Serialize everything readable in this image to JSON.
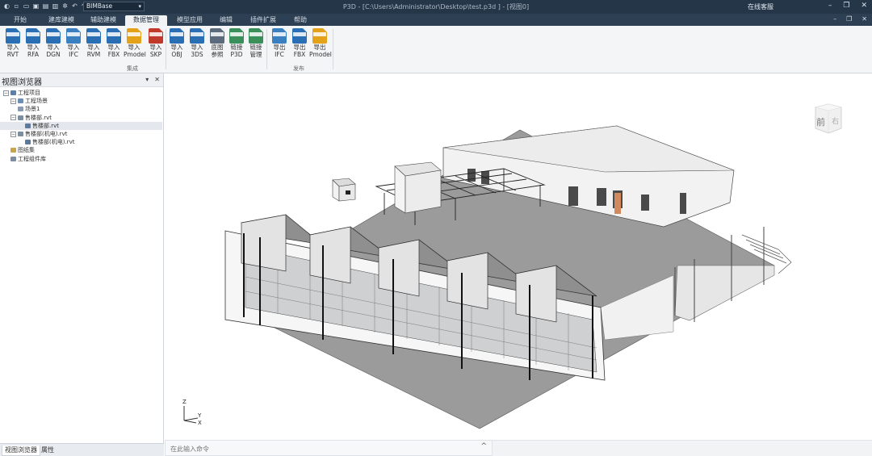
{
  "titlebar": {
    "quick_access_icons": [
      "app-logo-icon",
      "new-file-icon",
      "open-folder-icon",
      "save-icon",
      "save-as-icon",
      "print-icon",
      "settings-icon",
      "undo-icon",
      "redo-icon",
      "more-icon"
    ],
    "workspace": "BIMBase",
    "title": "P3D - [C:\\Users\\Administrator\\Desktop\\test.p3d ] - [视图0]",
    "online_service": "在线客服",
    "window_controls": [
      "minimize-icon",
      "restore-icon",
      "close-icon"
    ]
  },
  "menu": {
    "tabs": [
      "开始",
      "建库建模",
      "辅助建模",
      "数据管理",
      "模型应用",
      "编辑",
      "插件扩展",
      "帮助"
    ],
    "active": "数据管理",
    "mdi_controls": [
      "minimize-icon",
      "restore-icon",
      "close-icon"
    ]
  },
  "ribbon": {
    "buttons": [
      {
        "l1": "导入",
        "l2": "RVT",
        "color": "#2a6fb3",
        "tag": "RVT"
      },
      {
        "l1": "导入",
        "l2": "RFA",
        "color": "#2a6fb3",
        "tag": "RFA"
      },
      {
        "l1": "导入",
        "l2": "DGN",
        "color": "#2a6fb3",
        "tag": "DGN"
      },
      {
        "l1": "导入",
        "l2": "IFC",
        "color": "#3a7fbf",
        "tag": "IFC"
      },
      {
        "l1": "导入",
        "l2": "RVM",
        "color": "#2a6fb3",
        "tag": "RVM"
      },
      {
        "l1": "导入",
        "l2": "FBX",
        "color": "#2a6fb3",
        "tag": "FBX"
      },
      {
        "l1": "导入",
        "l2": "Pmodel",
        "color": "#e3a21a",
        "tag": "Pm"
      },
      {
        "l1": "导入",
        "l2": "SKP",
        "color": "#c0392b",
        "tag": "SKP"
      },
      {
        "l1": "导入",
        "l2": "OBJ",
        "color": "#2a6fb3",
        "tag": "OBJ"
      },
      {
        "l1": "导入",
        "l2": "3DS",
        "color": "#2a6fb3",
        "tag": "3DS"
      },
      {
        "l1": "底图",
        "l2": "参照",
        "color": "#5b6b7c",
        "tag": "DWG"
      },
      {
        "l1": "链接",
        "l2": "P3D",
        "color": "#3b8f5a",
        "tag": "∞"
      },
      {
        "l1": "链接",
        "l2": "管理",
        "color": "#3b8f5a",
        "tag": "≡"
      },
      {
        "l1": "导出",
        "l2": "IFC",
        "color": "#3a7fbf",
        "tag": "IFC"
      },
      {
        "l1": "导出",
        "l2": "FBX",
        "color": "#2a6fb3",
        "tag": "FBX"
      },
      {
        "l1": "导出",
        "l2": "Pmodel",
        "color": "#e3a21a",
        "tag": "Pm"
      }
    ],
    "groups": [
      "集成",
      "发布"
    ]
  },
  "browser": {
    "title": "视图浏览器",
    "tree": [
      {
        "label": "工程项目",
        "depth": 0,
        "toggle": "⊟",
        "icon_color": "#5a7fa8"
      },
      {
        "label": "工程场景",
        "depth": 1,
        "toggle": "⊟",
        "icon_color": "#6f8fb0"
      },
      {
        "label": "场景1",
        "depth": 2,
        "toggle": "",
        "icon_color": "#8a9bb0"
      },
      {
        "label": "售楼部.rvt",
        "depth": 1,
        "toggle": "⊟",
        "icon_color": "#7d8ea3"
      },
      {
        "label": "售楼部.rvt",
        "depth": 3,
        "toggle": "",
        "icon_color": "#5b7aa0",
        "selected": true
      },
      {
        "label": "售楼部(机电).rvt",
        "depth": 1,
        "toggle": "⊟",
        "icon_color": "#7d8ea3"
      },
      {
        "label": "售楼部(机电).rvt",
        "depth": 3,
        "toggle": "",
        "icon_color": "#5b7aa0"
      },
      {
        "label": "图纸集",
        "depth": 1,
        "toggle": "",
        "icon_color": "#c9a448"
      },
      {
        "label": "工程组件库",
        "depth": 1,
        "toggle": "",
        "icon_color": "#7d8ea3"
      }
    ],
    "bottom_tabs": [
      "视图浏览器",
      "属性"
    ]
  },
  "viewport": {
    "navcube_face": "前",
    "navcube_side": "右",
    "axes": {
      "z": "Z",
      "y": "Y",
      "x": "X"
    }
  },
  "command": {
    "placeholder": "在此输入命令",
    "toggle": "^"
  }
}
